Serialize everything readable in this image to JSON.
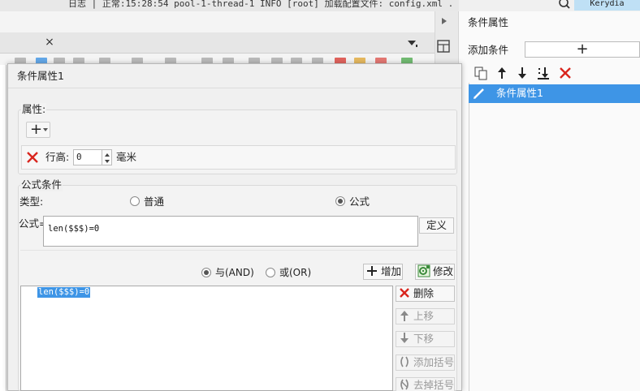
{
  "topbar": {
    "log_text": "日志 | 正常:15:28:54 pool-1-thread-1 INFO [root] 加载配置文件: config.xml .",
    "user": "Kerydia"
  },
  "right_panel": {
    "title": "条件属性",
    "add_condition_label": "添加条件",
    "add_condition_button": "+",
    "condition_items": [
      "条件属性1"
    ]
  },
  "dialog": {
    "title": "条件属性1",
    "attributes": {
      "label": "属性:",
      "add_button": "+",
      "row_height_label": "行高:",
      "row_height_value": "0",
      "row_height_unit": "毫米"
    },
    "formula_condition": {
      "label": "公式条件",
      "type_label": "类型:",
      "type_normal": "普通",
      "type_formula": "公式",
      "selected_type": "公式",
      "formula_label": "公式=",
      "formula_value": "len($$$)=0",
      "define_button": "定义",
      "logic_and": "与(AND)",
      "logic_or": "或(OR)",
      "selected_logic": "与(AND)",
      "add_button": "增加",
      "modify_button": "修改"
    },
    "expression_list": {
      "items": [
        "len($$$)=0"
      ],
      "delete_button": "删除",
      "move_up_button": "上移",
      "move_down_button": "下移",
      "add_bracket_button": "添加括号",
      "remove_bracket_button": "去掉括号"
    }
  },
  "colors": {
    "selection_blue": "#3e95e6",
    "delete_red": "#d9251d"
  }
}
